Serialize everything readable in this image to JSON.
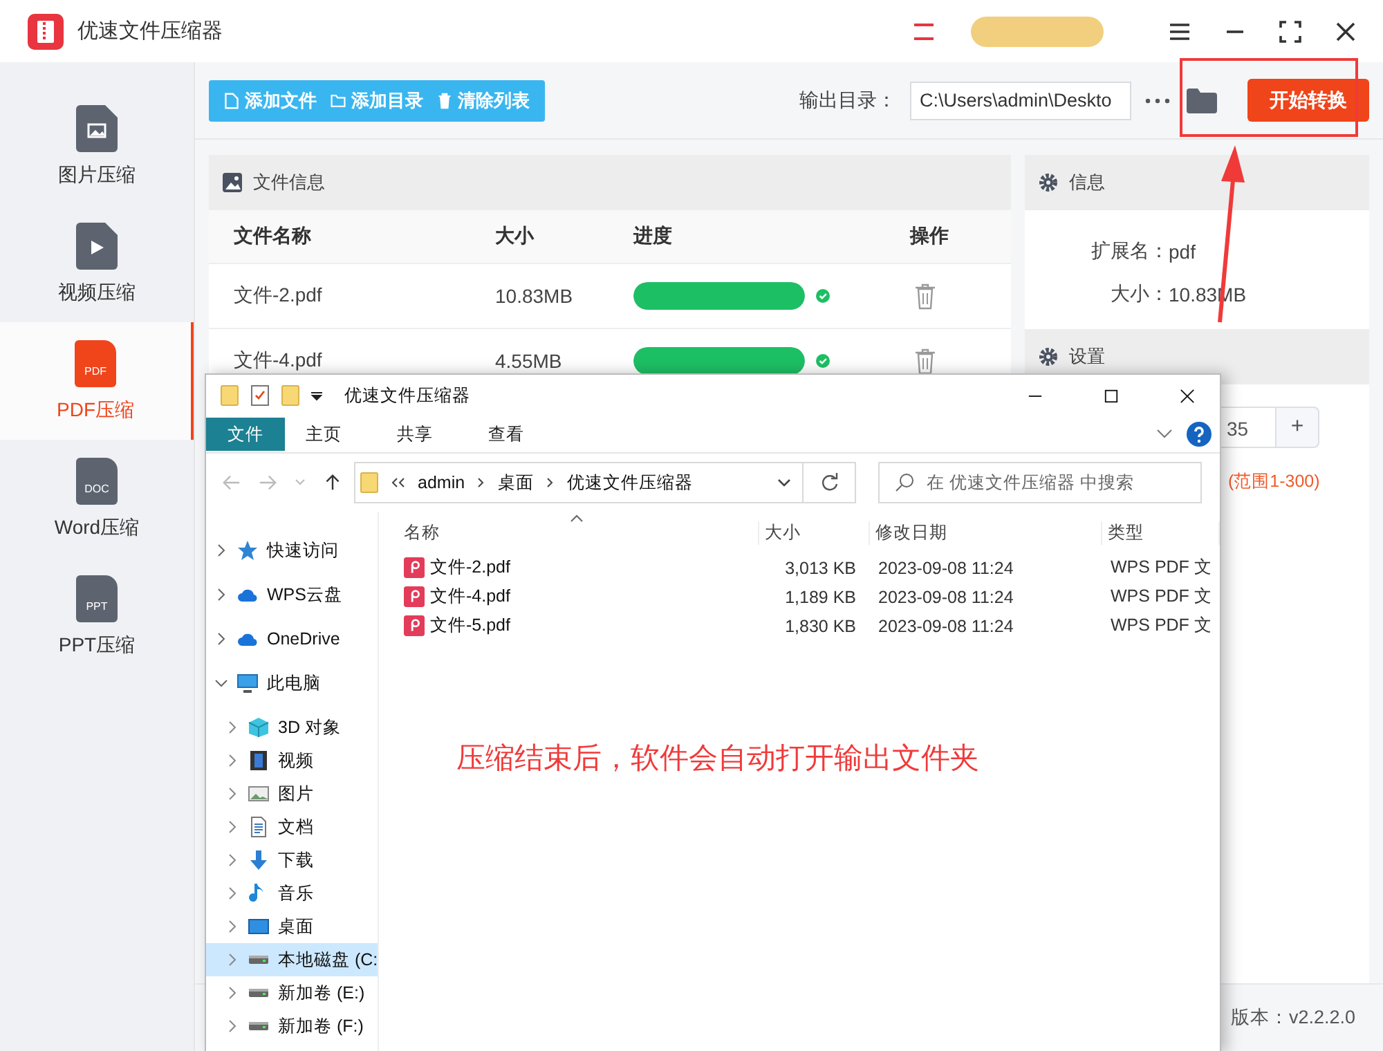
{
  "app": {
    "title": "优速文件压缩器",
    "toolbar": [
      {
        "kind": "file",
        "label": "添加文件"
      },
      {
        "kind": "folder",
        "label": "添加目录"
      },
      {
        "kind": "trash",
        "label": "清除列表"
      }
    ],
    "output": {
      "label": "输出目录：",
      "value": "C:\\Users\\admin\\Deskto"
    },
    "start_button": "开始转换",
    "sidebar": [
      {
        "kind": "image",
        "label": "图片压缩",
        "selected": false
      },
      {
        "kind": "video",
        "label": "视频压缩",
        "selected": false
      },
      {
        "kind": "doc",
        "badge": "PDF",
        "label": "PDF压缩",
        "selected": true
      },
      {
        "kind": "doc",
        "badge": "DOC",
        "label": "Word压缩",
        "selected": false
      },
      {
        "kind": "doc",
        "badge": "PPT",
        "label": "PPT压缩",
        "selected": false
      }
    ],
    "files": {
      "title": "文件信息",
      "columns": [
        "文件名称",
        "大小",
        "进度",
        "操作"
      ],
      "rows": [
        {
          "name": "文件-2.pdf",
          "size": "10.83MB",
          "level": 1
        },
        {
          "name": "文件-4.pdf",
          "size": "4.55MB",
          "level": 1
        }
      ]
    },
    "info": {
      "title": "信息",
      "fields": [
        {
          "label": "扩展名：",
          "value": "pdf"
        },
        {
          "label": "大小：",
          "value": "10.83MB"
        }
      ]
    },
    "settings": {
      "title": "设置",
      "value": "35",
      "step": "+",
      "hint": "(范围1-300)"
    },
    "version": "版本：v2.2.2.0"
  },
  "explorer": {
    "title": "优速文件压缩器",
    "tabs": [
      {
        "label": "文件",
        "selected": true
      },
      {
        "label": "主页",
        "selected": false
      },
      {
        "label": "共享",
        "selected": false
      },
      {
        "label": "查看",
        "selected": false
      }
    ],
    "path": [
      "admin",
      "桌面",
      "优速文件压缩器"
    ],
    "search": {
      "placeholder": "在 优速文件压缩器 中搜索"
    },
    "columns": [
      "名称",
      "大小",
      "修改日期",
      "类型"
    ],
    "files": [
      {
        "name": "文件-2.pdf",
        "size": "3,013 KB",
        "date": "2023-09-08 11:24",
        "type": "WPS PDF 文"
      },
      {
        "name": "文件-4.pdf",
        "size": "1,189 KB",
        "date": "2023-09-08 11:24",
        "type": "WPS PDF 文"
      },
      {
        "name": "文件-5.pdf",
        "size": "1,830 KB",
        "date": "2023-09-08 11:24",
        "type": "WPS PDF 文"
      }
    ],
    "nav": [
      {
        "kind": "star",
        "label": "快速访问",
        "expanded": false,
        "selected": false
      },
      {
        "kind": "cloud",
        "label": "WPS云盘",
        "expanded": false,
        "selected": false
      },
      {
        "kind": "cloud",
        "label": "OneDrive",
        "expanded": false,
        "selected": false
      },
      {
        "kind": "pc",
        "label": "此电脑",
        "expanded": true,
        "selected": false,
        "children": [
          {
            "kind": "cube",
            "label": "3D 对象",
            "expanded": false,
            "selected": false
          },
          {
            "kind": "film",
            "label": "视频",
            "expanded": false,
            "selected": false
          },
          {
            "kind": "picture",
            "label": "图片",
            "expanded": false,
            "selected": false
          },
          {
            "kind": "doc",
            "label": "文档",
            "expanded": false,
            "selected": false
          },
          {
            "kind": "download",
            "label": "下载",
            "expanded": false,
            "selected": false
          },
          {
            "kind": "music",
            "label": "音乐",
            "expanded": false,
            "selected": false
          },
          {
            "kind": "desktop",
            "label": "桌面",
            "expanded": false,
            "selected": false
          },
          {
            "kind": "drive",
            "label": "本地磁盘 (C:",
            "expanded": false,
            "selected": true
          },
          {
            "kind": "drive",
            "label": "新加卷 (E:)",
            "expanded": false,
            "selected": false
          },
          {
            "kind": "drive",
            "label": "新加卷 (F:)",
            "expanded": false,
            "selected": false
          }
        ]
      }
    ]
  },
  "annotation": {
    "text": "压缩结束后，软件会自动打开输出文件夹"
  }
}
